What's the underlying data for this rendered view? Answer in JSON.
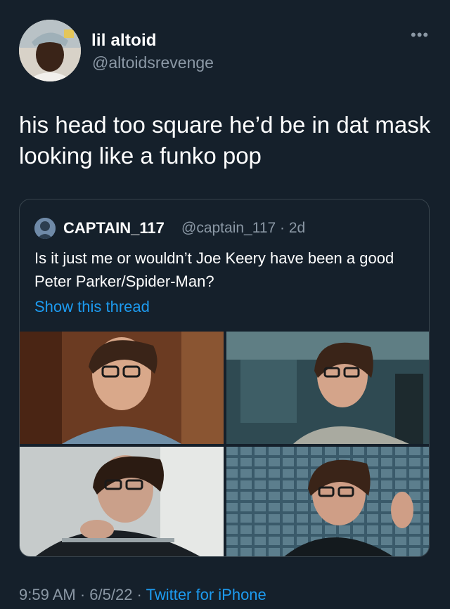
{
  "author": {
    "name": "lil altoid",
    "handle": "@altoidsrevenge"
  },
  "tweet": {
    "text": "his head too square he’d be in dat mask looking like a funko pop"
  },
  "more_icon": "more-dots-icon",
  "quote": {
    "name": "CAPTAIN_117",
    "handle_time": "@captain_117 · 2d",
    "text": "Is it just me or wouldn’t Joe Keery have been a good Peter Parker/Spider-Man?",
    "link": "Show this thread"
  },
  "footer": {
    "time_date": "9:59 AM · 6/5/22 · ",
    "source": "Twitter for iPhone"
  },
  "colors": {
    "background": "#15202b",
    "secondary_text": "#8b98a5",
    "link": "#1d9bf0",
    "border": "#38444d"
  }
}
